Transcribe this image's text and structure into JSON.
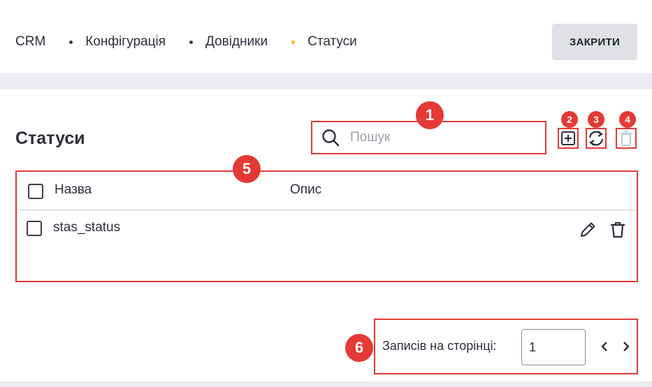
{
  "breadcrumb": [
    {
      "label": "CRM",
      "active": false
    },
    {
      "label": "Конфігурація",
      "active": false
    },
    {
      "label": "Довідники",
      "active": false
    },
    {
      "label": "Статуси",
      "active": true
    }
  ],
  "header": {
    "close_label": "ЗАКРИТИ"
  },
  "page": {
    "title": "Статуси"
  },
  "search": {
    "placeholder": "Пошук",
    "value": ""
  },
  "toolbar": {
    "add_icon": "plus-square-icon",
    "refresh_icon": "refresh-icon",
    "delete_icon": "trash-icon"
  },
  "table": {
    "columns": [
      "Назва",
      "Опис"
    ],
    "rows": [
      {
        "name": "stas_status",
        "description": ""
      }
    ]
  },
  "pagination": {
    "label": "Записів на сторінці:",
    "per_page": "1"
  },
  "annotations": [
    "1",
    "2",
    "3",
    "4",
    "5",
    "6"
  ],
  "colors": {
    "accent": "#e03a3a",
    "badge": "#e53935",
    "active_dot": "#f5b731"
  }
}
